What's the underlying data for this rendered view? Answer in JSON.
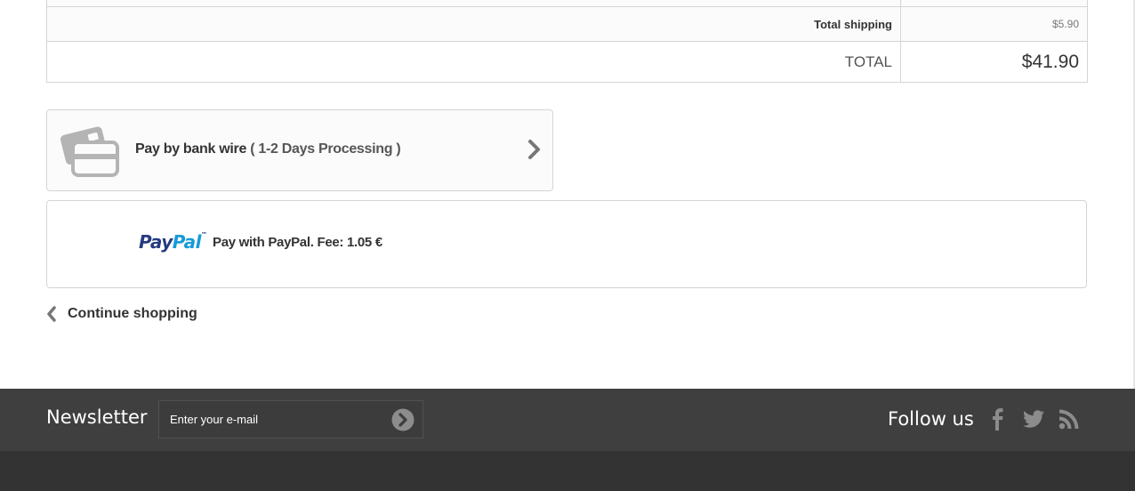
{
  "totals": {
    "shipping_label": "Total shipping",
    "shipping_value": "$5.90",
    "total_label": "TOTAL",
    "total_value": "$41.90"
  },
  "payment": {
    "bankwire": {
      "label": "Pay by bank wire",
      "detail": "( 1-2 Days Processing )",
      "icon": "credit-card-icon"
    },
    "paypal": {
      "logo_text_pay": "Pay",
      "logo_text_pal": "Pal",
      "logo_tm": "™",
      "label": "Pay with PayPal. Fee: 1.05 €"
    }
  },
  "navigation": {
    "continue_label": "Continue shopping"
  },
  "footer": {
    "newsletter_title": "Newsletter",
    "newsletter_placeholder": "Enter your e-mail",
    "follow_title": "Follow us",
    "social": [
      "facebook-icon",
      "twitter-icon",
      "rss-icon"
    ]
  },
  "colors": {
    "footer_band": "#3f3f3f",
    "footer_bottom": "#333333",
    "paypal_dark": "#253b80",
    "paypal_light": "#179bd7",
    "icon_gray": "#777777"
  }
}
